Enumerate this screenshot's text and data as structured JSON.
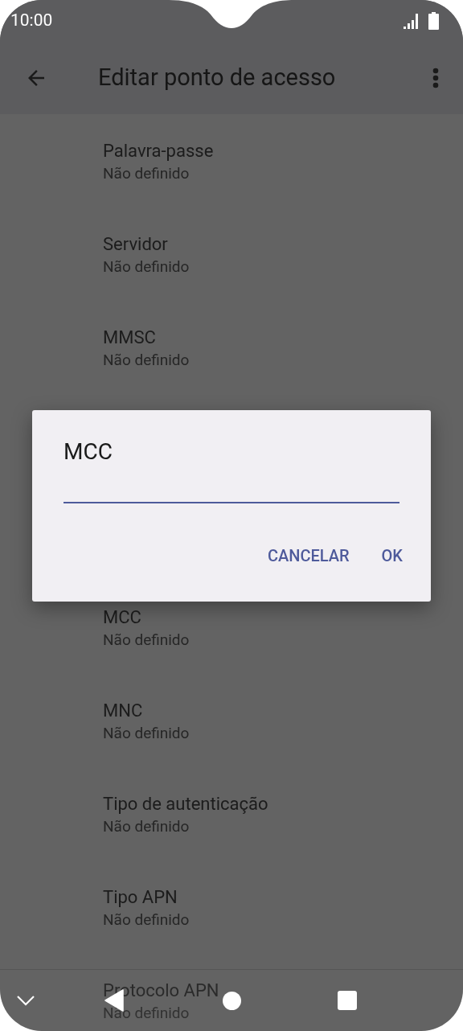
{
  "status_bar": {
    "time": "10:00"
  },
  "app_bar": {
    "title": "Editar ponto de acesso"
  },
  "settings_above": [
    {
      "title": "Palavra-passe",
      "value": "Não definido"
    },
    {
      "title": "Servidor",
      "value": "Não definido"
    },
    {
      "title": "MMSC",
      "value": "Não definido"
    }
  ],
  "settings_below": [
    {
      "title": "MCC",
      "value": "Não definido"
    },
    {
      "title": "MNC",
      "value": "Não definido"
    },
    {
      "title": "Tipo de autenticação",
      "value": "Não definido"
    },
    {
      "title": "Tipo APN",
      "value": "Não definido"
    },
    {
      "title": "Protocolo APN",
      "value": "Não definido"
    }
  ],
  "dialog": {
    "title": "MCC",
    "buttons": [
      "CANCELAR",
      "OK"
    ]
  }
}
